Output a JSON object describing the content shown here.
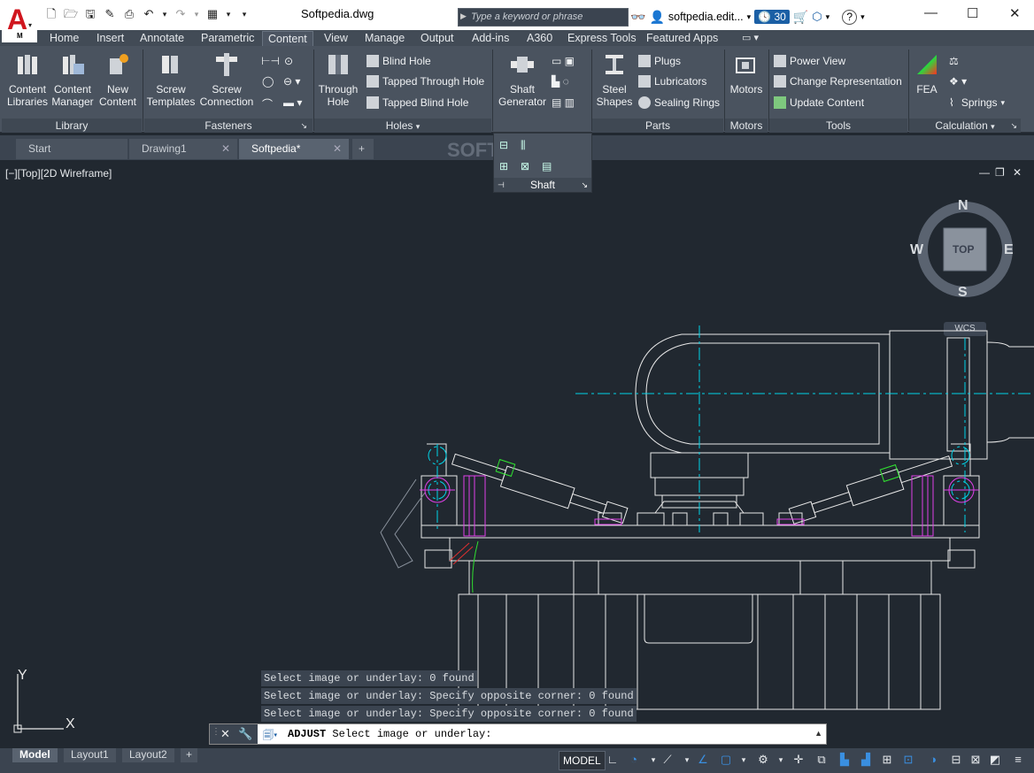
{
  "window": {
    "title": "Softpedia.dwg",
    "app_letter": "A",
    "app_sub": "M",
    "search_placeholder": "Type a keyword or phrase",
    "user": "softpedia.edit...",
    "clock_count": "30"
  },
  "ribbon_tabs": [
    "Home",
    "Insert",
    "Annotate",
    "Parametric",
    "Content",
    "View",
    "Manage",
    "Output",
    "Add-ins",
    "A360",
    "Express Tools",
    "Featured Apps"
  ],
  "ribbon": {
    "library": {
      "title": "Library",
      "buttons": [
        {
          "l1": "Content",
          "l2": "Libraries"
        },
        {
          "l1": "Content",
          "l2": "Manager"
        },
        {
          "l1": "New",
          "l2": "Content"
        }
      ]
    },
    "fasteners": {
      "title": "Fasteners",
      "buttons": [
        {
          "l1": "Screw",
          "l2": "Templates"
        },
        {
          "l1": "Screw",
          "l2": "Connection"
        }
      ]
    },
    "holes": {
      "title": "Holes",
      "big": {
        "l1": "Through",
        "l2": "Hole"
      },
      "small": [
        "Blind Hole",
        "Tapped Through Hole",
        "Tapped Blind Hole"
      ]
    },
    "shaft": {
      "title": "Shaft",
      "big": {
        "l1": "Shaft",
        "l2": "Generator"
      }
    },
    "parts": {
      "title": "Parts",
      "big": {
        "l1": "Steel",
        "l2": "Shapes"
      },
      "small": [
        "Plugs",
        "Lubricators",
        "Sealing Rings"
      ]
    },
    "motors": {
      "title": "Motors",
      "big": {
        "l1": "Motors"
      }
    },
    "tools": {
      "title": "Tools",
      "small": [
        "Power View",
        "Change Representation",
        "Update Content"
      ]
    },
    "calculation": {
      "title": "Calculation",
      "big": {
        "l1": "FEA"
      },
      "small": [
        "Springs"
      ]
    }
  },
  "file_tabs": [
    "Start",
    "Drawing1",
    "Softpedia*"
  ],
  "viewport": {
    "label": "[−][Top][2D Wireframe]",
    "compass": {
      "n": "N",
      "s": "S",
      "e": "E",
      "w": "W",
      "center": "TOP"
    },
    "wcs": "WCS",
    "ucs": {
      "x": "X",
      "y": "Y"
    }
  },
  "command": {
    "history": [
      "Select image or underlay: 0 found",
      "Select image or underlay: Specify opposite corner: 0 found",
      "Select image or underlay: Specify opposite corner: 0 found"
    ],
    "prompt_cmd": "ADJUST",
    "prompt_text": "Select image or underlay:"
  },
  "layout_tabs": [
    "Model",
    "Layout1",
    "Layout2"
  ],
  "status": {
    "model": "MODEL"
  },
  "watermark": "SOFTPEDIA",
  "colors": {
    "app_red": "#d0161e",
    "cad_bg": "#212830",
    "cyan": "#00d5e8",
    "magenta": "#e040e8",
    "green": "#30e030"
  }
}
